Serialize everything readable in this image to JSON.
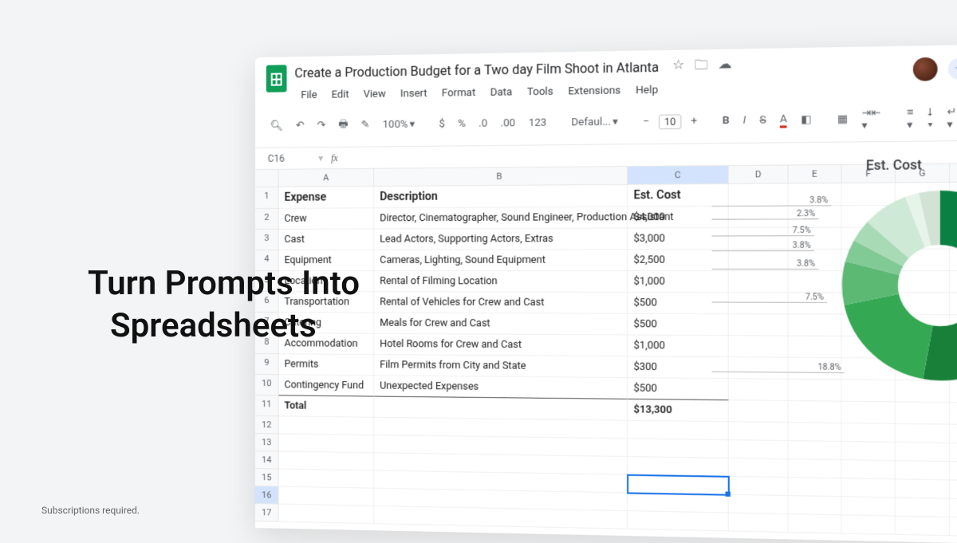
{
  "overlay": {
    "line1": "Turn Prompts Into",
    "line2": "Spreadsheets"
  },
  "footnote": "Subscriptions required.",
  "doc": {
    "title": "Create a Production Budget for a Two day Film Shoot in Atlanta",
    "menus": [
      "File",
      "Edit",
      "View",
      "Insert",
      "Format",
      "Data",
      "Tools",
      "Extensions",
      "Help"
    ],
    "cell_ref": "C16",
    "zoom": "100%",
    "font": "Defaul...",
    "fontsize": "10"
  },
  "columns": [
    "A",
    "B",
    "C",
    "D",
    "E",
    "F",
    "G"
  ],
  "headers": {
    "a": "Expense",
    "b": "Description",
    "c": "Est. Cost"
  },
  "rows": [
    {
      "a": "Crew",
      "b": "Director, Cinematographer, Sound Engineer, Production Assistant",
      "c": "$4,000"
    },
    {
      "a": "Cast",
      "b": "Lead Actors, Supporting Actors, Extras",
      "c": "$3,000"
    },
    {
      "a": "Equipment",
      "b": "Cameras, Lighting, Sound Equipment",
      "c": "$2,500"
    },
    {
      "a": "Location",
      "b": "Rental of Filming Location",
      "c": "$1,000"
    },
    {
      "a": "Transportation",
      "b": "Rental of Vehicles for Crew and Cast",
      "c": "$500"
    },
    {
      "a": "Catering",
      "b": "Meals for Crew and Cast",
      "c": "$500"
    },
    {
      "a": "Accommodation",
      "b": "Hotel Rooms for Crew and Cast",
      "c": "$1,000"
    },
    {
      "a": "Permits",
      "b": "Film Permits from City and State",
      "c": "$300"
    },
    {
      "a": "Contingency Fund",
      "b": "Unexpected Expenses",
      "c": "$500"
    }
  ],
  "total": {
    "label": "Total",
    "value": "$13,300"
  },
  "chart_data": {
    "type": "pie",
    "title": "Est. Cost",
    "categories": [
      "Crew",
      "Cast",
      "Equipment",
      "Location",
      "Transportation",
      "Catering",
      "Accommodation",
      "Permits",
      "Contingency Fund"
    ],
    "values": [
      4000,
      3000,
      2500,
      1000,
      500,
      500,
      1000,
      300,
      500
    ],
    "labels": [
      "3.8%",
      "2.3%",
      "7.5%",
      "3.8%",
      "3.8%",
      "7.5%",
      "18.8%"
    ]
  }
}
